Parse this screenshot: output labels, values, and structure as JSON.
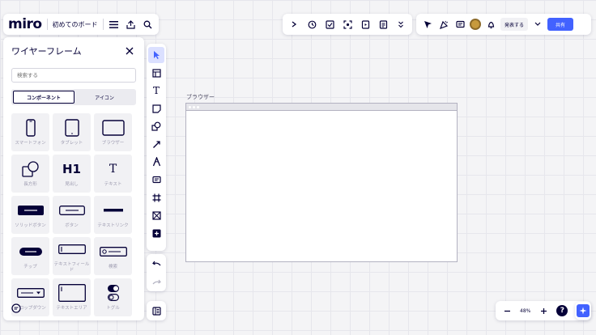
{
  "topbar": {
    "logo": "miro",
    "board_name": "初めてのボード",
    "present_label": "発表する",
    "share_label": "共有"
  },
  "library": {
    "title": "ワイヤーフレーム",
    "search_placeholder": "検索する",
    "tabs": [
      "コンポーネント",
      "アイコン"
    ],
    "tiles": [
      {
        "label": "スマートフォン",
        "icon": "smartphone"
      },
      {
        "label": "タブレット",
        "icon": "tablet"
      },
      {
        "label": "ブラウザー",
        "icon": "browser"
      },
      {
        "label": "長方形",
        "icon": "shape"
      },
      {
        "label": "見出し",
        "icon": "heading",
        "glyph": "H1"
      },
      {
        "label": "テキスト",
        "icon": "text",
        "glyph": "T"
      },
      {
        "label": "ソリッドボタン",
        "icon": "solid-button"
      },
      {
        "label": "ボタン",
        "icon": "button"
      },
      {
        "label": "テキストリンク",
        "icon": "text-link"
      },
      {
        "label": "チップ",
        "icon": "chip"
      },
      {
        "label": "テキストフィールド",
        "icon": "text-field"
      },
      {
        "label": "検索",
        "icon": "search-field"
      },
      {
        "label": "ドロップダウン",
        "icon": "dropdown"
      },
      {
        "label": "テキストエリア",
        "icon": "text-area"
      },
      {
        "label": "トグル",
        "icon": "toggle"
      }
    ]
  },
  "canvas": {
    "frame_label": "ブラウザー"
  },
  "zoom": {
    "level": "48%",
    "help": "?"
  },
  "tools": [
    "select",
    "templates",
    "text",
    "sticky-note",
    "shapes",
    "pen",
    "connector",
    "comment",
    "frame",
    "wireframe",
    "add"
  ],
  "colors": {
    "accent": "#4262ff",
    "ink": "#050038",
    "tile_bg": "#f1f1f4"
  }
}
